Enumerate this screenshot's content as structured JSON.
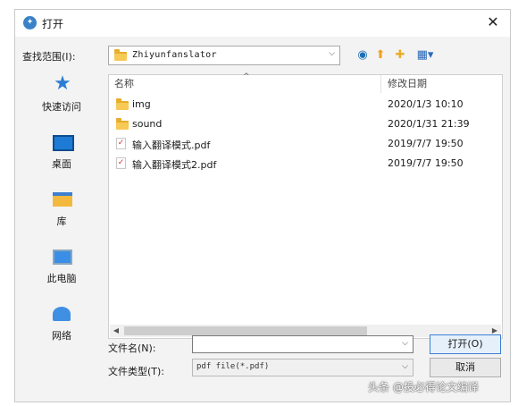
{
  "dialog": {
    "title": "打开",
    "close_glyph": "✕"
  },
  "lookin": {
    "label": "查找范围(I):",
    "value": "Zhiyunfanslator"
  },
  "places": [
    {
      "label": "快速访问",
      "icon": "quick-access-star-icon"
    },
    {
      "label": "桌面",
      "icon": "desktop-icon"
    },
    {
      "label": "库",
      "icon": "library-icon"
    },
    {
      "label": "此电脑",
      "icon": "this-pc-icon"
    },
    {
      "label": "网络",
      "icon": "network-icon"
    }
  ],
  "filelist": {
    "col_name": "名称",
    "col_date": "修改日期",
    "rows": [
      {
        "name": "img",
        "date": "2020/1/3 10:10",
        "type": "folder"
      },
      {
        "name": "sound",
        "date": "2020/1/31 21:39",
        "type": "folder"
      },
      {
        "name": "输入翻译模式.pdf",
        "date": "2019/7/7 19:50",
        "type": "pdf"
      },
      {
        "name": "输入翻译模式2.pdf",
        "date": "2019/7/7 19:50",
        "type": "pdf"
      }
    ]
  },
  "filename": {
    "label": "文件名(N):",
    "value": ""
  },
  "filetype": {
    "label": "文件类型(T):",
    "value": "pdf file(*.pdf)"
  },
  "buttons": {
    "open": "打开(O)",
    "cancel": "取消"
  },
  "watermark": "头条 @投必得论文编译",
  "colors": {
    "accent": "#3b7fd6",
    "folder": "#f7c955"
  }
}
